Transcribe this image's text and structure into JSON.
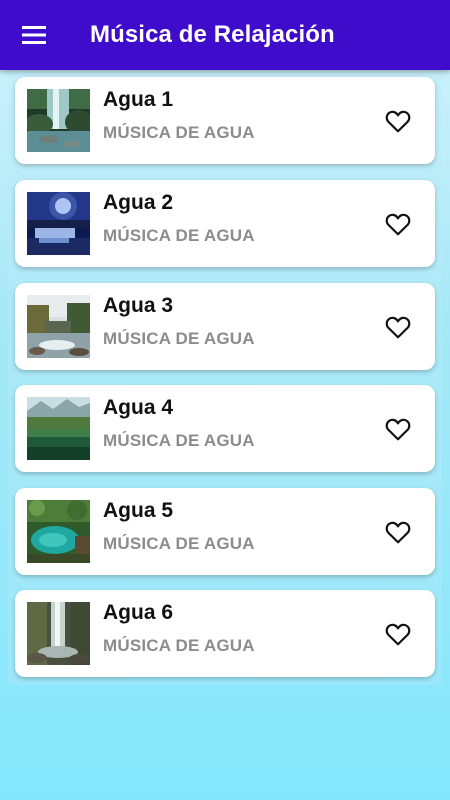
{
  "app": {
    "title": "Música de Relajación",
    "menu_icon": "hamburger-menu-icon",
    "accent_color": "#3f0ccc"
  },
  "tracks": [
    {
      "title": "Agua 1",
      "subtitle": "MÚSICA DE AGUA",
      "favorite": false,
      "thumbnail": "waterfall-rocks"
    },
    {
      "title": "Agua 2",
      "subtitle": "MÚSICA DE AGUA",
      "favorite": false,
      "thumbnail": "night-waterfall"
    },
    {
      "title": "Agua 3",
      "subtitle": "MÚSICA DE AGUA",
      "favorite": false,
      "thumbnail": "forest-river"
    },
    {
      "title": "Agua 4",
      "subtitle": "MÚSICA DE AGUA",
      "favorite": false,
      "thumbnail": "mountain-lake"
    },
    {
      "title": "Agua 5",
      "subtitle": "MÚSICA DE AGUA",
      "favorite": false,
      "thumbnail": "turquoise-lake"
    },
    {
      "title": "Agua 6",
      "subtitle": "MÚSICA DE AGUA",
      "favorite": false,
      "thumbnail": "canyon-waterfall"
    }
  ],
  "favorite_icon": "heart-outline-icon"
}
